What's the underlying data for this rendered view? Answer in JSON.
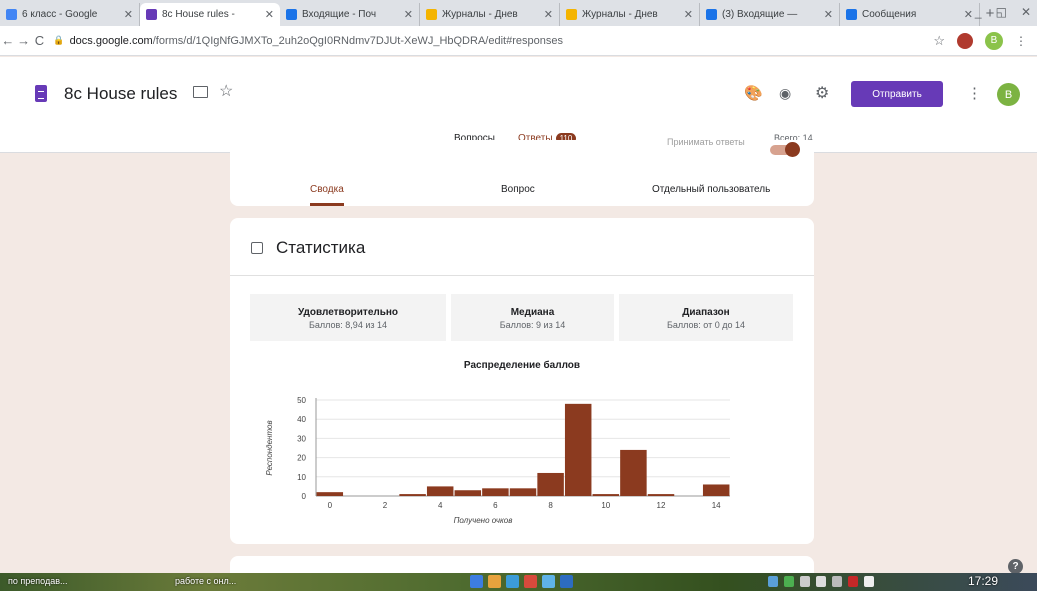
{
  "browser": {
    "tabs": [
      {
        "title": "6 класс - Google",
        "color": "#4285f4",
        "active": false
      },
      {
        "title": "8c House rules - ",
        "color": "#673ab7",
        "active": true
      },
      {
        "title": "Входящие - Поч",
        "color": "#1a73e8",
        "active": false
      },
      {
        "title": "Журналы - Днев",
        "color": "#f4b400",
        "active": false
      },
      {
        "title": "Журналы - Днев",
        "color": "#f4b400",
        "active": false
      },
      {
        "title": "(3) Входящие — ",
        "color": "#1a73e8",
        "active": false
      },
      {
        "title": "Сообщения",
        "color": "#1a73e8",
        "active": false
      }
    ],
    "url_host": "docs.google.com",
    "url_path": "/forms/d/1QIgNfGJMXTo_2uh2oQgI0RNdmv7DJUt-XeWJ_HbQDRA/edit#responses",
    "profile_initial": "B"
  },
  "form": {
    "title": "8c House rules",
    "send_label": "Отправить",
    "avatar_initial": "B",
    "tabs": {
      "questions": "Вопросы",
      "responses": "Ответы",
      "responses_count": "110"
    },
    "total": "Всего: 14",
    "accept_label": "Принимать ответы",
    "subtabs": [
      "Сводка",
      "Вопрос",
      "Отдельный пользователь"
    ]
  },
  "stats": {
    "title": "Статистика",
    "boxes": [
      {
        "label": "Удовлетворительно",
        "value": "Баллов: 8,94 из 14"
      },
      {
        "label": "Медиана",
        "value": "Баллов: 9 из 14"
      },
      {
        "label": "Диапазон",
        "value": "Баллов: от 0 до 14"
      }
    ]
  },
  "chart_data": {
    "type": "bar",
    "title": "Распределение баллов",
    "xlabel": "Получено очков",
    "ylabel": "Респондентов",
    "ylim": [
      0,
      50
    ],
    "yticks": [
      0,
      10,
      20,
      30,
      40,
      50
    ],
    "xticks": [
      0,
      2,
      4,
      6,
      8,
      10,
      12,
      14
    ],
    "x": [
      0,
      3,
      4,
      5,
      6,
      7,
      8,
      9,
      10,
      11,
      12,
      14
    ],
    "values": [
      2,
      1,
      5,
      3,
      4,
      4,
      12,
      48,
      1,
      24,
      1,
      6
    ],
    "color": "#8b3a1f"
  },
  "taskbar": {
    "item1": "по преподав...",
    "item2": "работе с онл...",
    "clock": "17:29"
  }
}
